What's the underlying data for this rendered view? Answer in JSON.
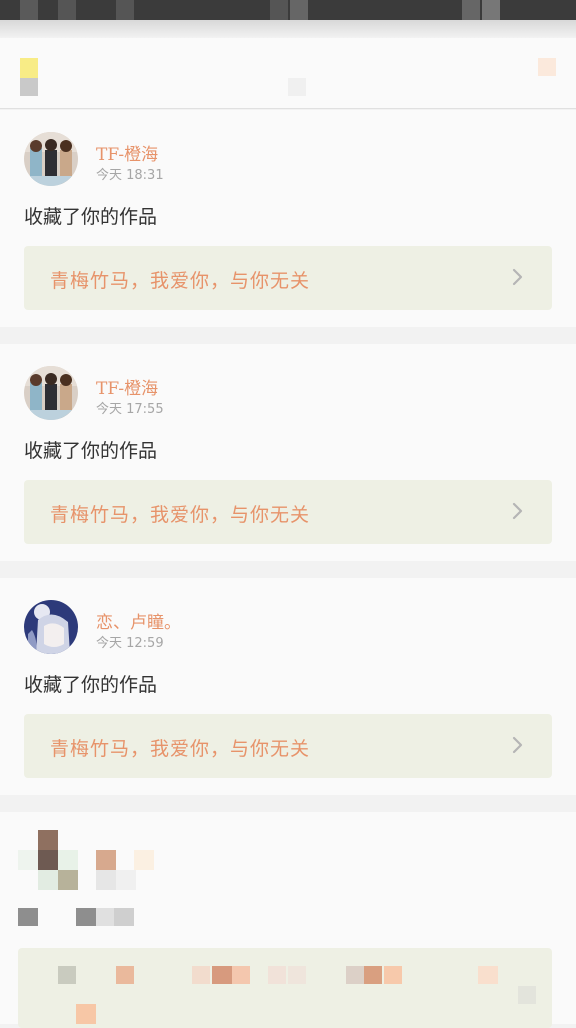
{
  "feed": [
    {
      "username": "TF-橙海",
      "time": "今天 18:31",
      "action": "收藏了你的作品",
      "work_title": "青梅竹马，我爱你，与你无关",
      "avatar_icon": "group-photo-avatar-icon"
    },
    {
      "username": "TF-橙海",
      "time": "今天 17:55",
      "action": "收藏了你的作品",
      "work_title": "青梅竹马，我爱你，与你无关",
      "avatar_icon": "group-photo-avatar-icon"
    },
    {
      "username": "恋、卢瞳。",
      "time": "今天 12:59",
      "action": "收藏了你的作品",
      "work_title": "青梅竹马，我爱你，与你无关",
      "avatar_icon": "anime-girl-avatar-icon"
    }
  ],
  "colors": {
    "username": "#e7936a",
    "work_card": "#eef0e4",
    "background": "#f2f2f2",
    "card": "#fafafa"
  }
}
